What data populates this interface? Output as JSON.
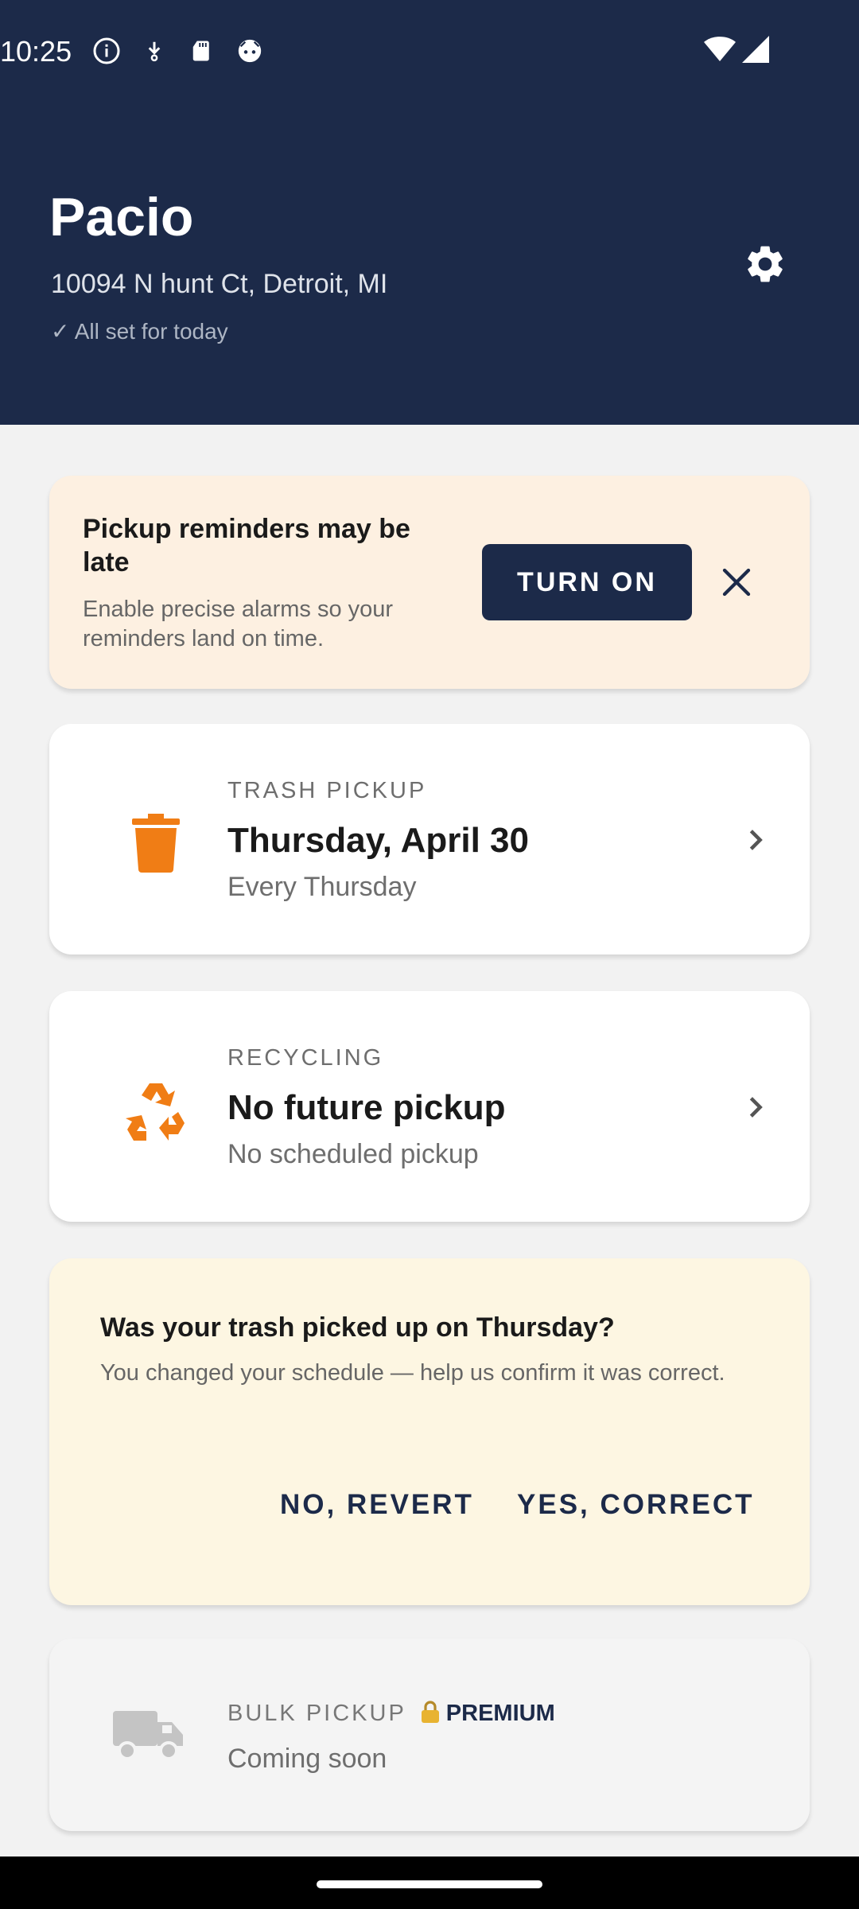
{
  "status_bar": {
    "time": "10:25",
    "icons": [
      "info-icon",
      "download-icon",
      "sd-card-icon",
      "notification-icon",
      "wifi-icon",
      "signal-icon"
    ]
  },
  "header": {
    "title": "Pacio",
    "address": "10094 N hunt Ct, Detroit, MI",
    "status": "✓ All set for today",
    "settings_icon": "gear-icon"
  },
  "reminder": {
    "title": "Pickup reminders may be late",
    "text": "Enable precise alarms so your reminders land on time.",
    "button_label": "TURN ON",
    "dismiss_icon": "close-icon"
  },
  "trash": {
    "icon": "trash-can-icon",
    "label": "TRASH PICKUP",
    "date": "Thursday, April 30",
    "frequency": "Every Thursday"
  },
  "recycling": {
    "icon": "recycle-icon",
    "label": "RECYCLING",
    "date": "No future pickup",
    "frequency": "No scheduled pickup"
  },
  "confirm": {
    "title": "Was your trash picked up on Thursday?",
    "text": "You changed your schedule — help us confirm it was correct.",
    "no_label": "NO, REVERT",
    "yes_label": "YES, CORRECT"
  },
  "bulk": {
    "icon": "truck-icon",
    "label": "BULK PICKUP",
    "badge": "PREMIUM",
    "badge_icon": "lock-icon",
    "status": "Coming soon"
  },
  "colors": {
    "header_bg": "#1c2a49",
    "accent_orange": "#f07d15",
    "reminder_bg": "#fdf0e1",
    "confirm_bg": "#fdf6e2"
  }
}
